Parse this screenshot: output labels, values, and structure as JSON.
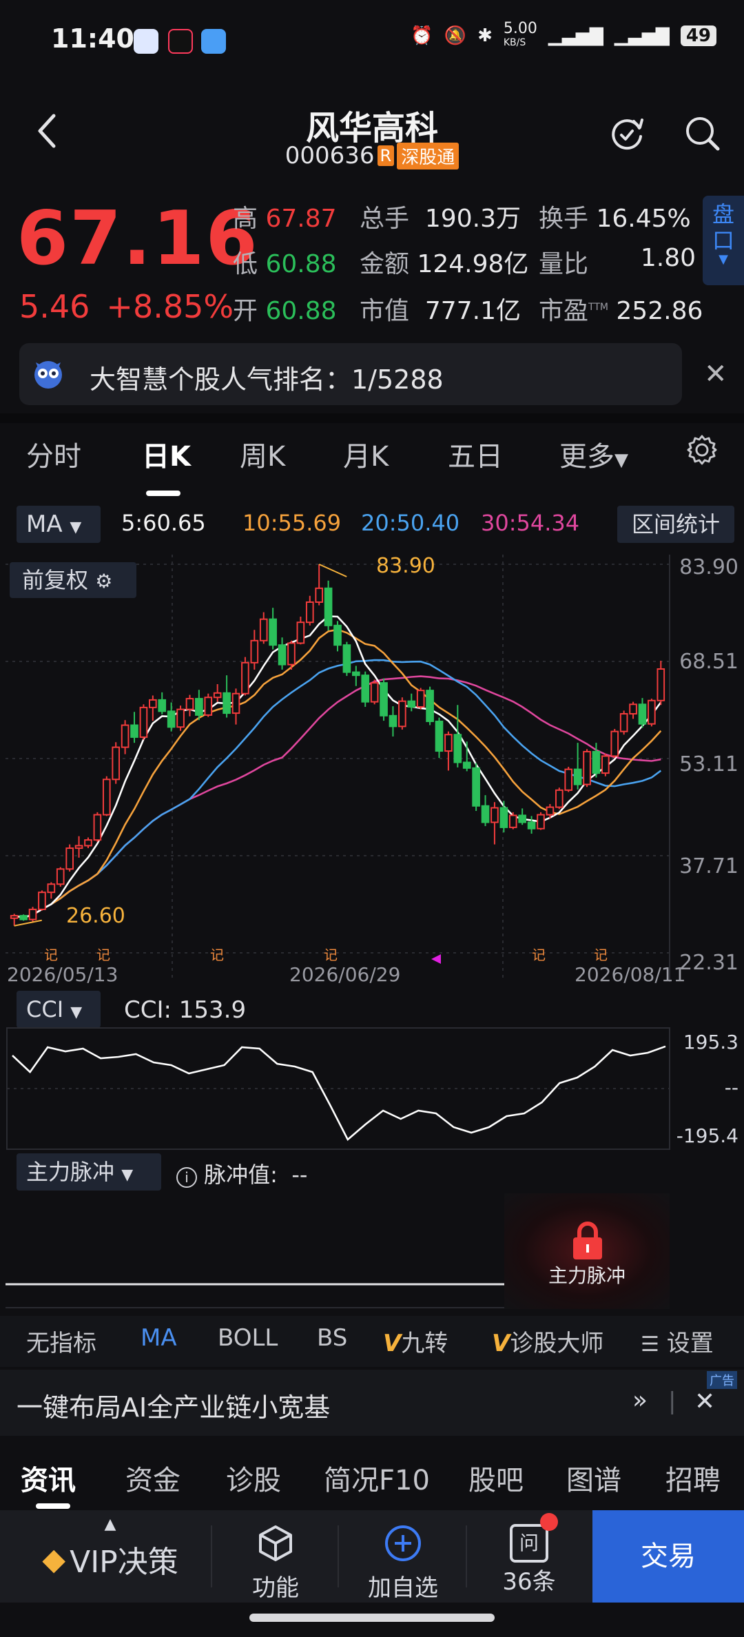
{
  "status": {
    "time": "11:40",
    "net_speed": "5.00",
    "net_unit": "KB/S",
    "battery": "49"
  },
  "header": {
    "name": "风华高科",
    "code": "000636",
    "tag_r": "R",
    "tag_connect": "深股通"
  },
  "quote": {
    "price": "67.16",
    "change": "5.46",
    "change_pct": "+8.85%",
    "high_label": "高",
    "high": "67.87",
    "low_label": "低",
    "low": "60.88",
    "open_label": "开",
    "open": "60.88",
    "vol_label": "总手",
    "vol": "190.3万",
    "amount_label": "金额",
    "amount": "124.98亿",
    "mktcap_label": "市值",
    "mktcap": "777.1亿",
    "turnover_label": "换手",
    "turnover": "16.45%",
    "volratio_label": "量比",
    "volratio": "1.80",
    "pe_label": "市盈",
    "pe_suffix": "TTM",
    "pe": "252.86",
    "pankou": "盘口"
  },
  "rank": {
    "text": "大智慧个股人气排名：1/5288"
  },
  "period_tabs": [
    "分时",
    "日K",
    "周K",
    "月K",
    "五日",
    "更多"
  ],
  "ma_row": {
    "select": "MA",
    "ma5": "5:60.65",
    "ma10": "10:55.69",
    "ma20": "20:50.40",
    "ma30": "30:54.34",
    "interval": "区间统计"
  },
  "fq_label": "前复权",
  "colors": {
    "up": "#f23c3c",
    "down": "#2bbf5a",
    "ma5": "#ffffff",
    "ma10": "#f6a23c",
    "ma20": "#4aa3f0",
    "ma30": "#e0479e"
  },
  "chart_data": {
    "type": "candlestick",
    "y_ticks": [
      "83.90",
      "68.51",
      "53.11",
      "37.71",
      "22.31"
    ],
    "x_labels": [
      "2026/05/13",
      "2026/06/29",
      "2026/08/11"
    ],
    "high_marker": "83.90",
    "low_marker": "26.60",
    "ylim": [
      22.31,
      83.9
    ],
    "candles": [
      [
        27.8,
        28.5,
        26.6,
        28.2
      ],
      [
        28.2,
        28.4,
        27.4,
        27.6
      ],
      [
        27.6,
        29.6,
        27.2,
        29.2
      ],
      [
        29.2,
        32.2,
        29.0,
        31.9
      ],
      [
        31.9,
        33.5,
        30.9,
        33.2
      ],
      [
        33.2,
        35.9,
        32.8,
        35.6
      ],
      [
        35.6,
        39.5,
        35.2,
        38.9
      ],
      [
        38.9,
        40.8,
        37.4,
        39.3
      ],
      [
        39.3,
        40.6,
        38.9,
        40.2
      ],
      [
        40.2,
        44.6,
        39.9,
        44.2
      ],
      [
        44.2,
        50.3,
        44.0,
        49.8
      ],
      [
        49.8,
        55.7,
        49.1,
        54.9
      ],
      [
        54.9,
        59.2,
        53.8,
        58.4
      ],
      [
        58.4,
        60.5,
        55.6,
        56.5
      ],
      [
        56.5,
        61.7,
        56.1,
        61.2
      ],
      [
        61.2,
        63.1,
        59.1,
        62.4
      ],
      [
        62.4,
        63.6,
        60.1,
        60.6
      ],
      [
        60.6,
        62.0,
        57.4,
        58.1
      ],
      [
        58.1,
        61.5,
        57.5,
        60.9
      ],
      [
        60.9,
        63.2,
        59.8,
        62.6
      ],
      [
        62.6,
        64.0,
        59.2,
        60.0
      ],
      [
        60.0,
        63.4,
        59.7,
        62.8
      ],
      [
        62.8,
        64.9,
        62.1,
        63.5
      ],
      [
        63.5,
        66.3,
        59.6,
        60.3
      ],
      [
        60.3,
        64.2,
        58.5,
        63.4
      ],
      [
        63.4,
        69.2,
        63.1,
        68.3
      ],
      [
        68.3,
        73.5,
        67.2,
        71.8
      ],
      [
        71.8,
        76.3,
        71.3,
        75.2
      ],
      [
        75.2,
        77.0,
        70.4,
        71.1
      ],
      [
        71.1,
        72.3,
        67.2,
        68.0
      ],
      [
        68.0,
        71.8,
        67.2,
        71.4
      ],
      [
        71.4,
        75.6,
        71.2,
        74.7
      ],
      [
        74.7,
        78.9,
        74.2,
        77.9
      ],
      [
        77.9,
        83.9,
        77.4,
        80.1
      ],
      [
        80.1,
        81.3,
        73.4,
        74.2
      ],
      [
        74.2,
        74.9,
        70.1,
        71.1
      ],
      [
        71.1,
        71.6,
        66.2,
        66.8
      ],
      [
        66.8,
        67.8,
        64.6,
        66.3
      ],
      [
        66.3,
        66.9,
        61.3,
        62.1
      ],
      [
        62.1,
        65.6,
        61.7,
        65.1
      ],
      [
        65.1,
        65.8,
        59.1,
        59.9
      ],
      [
        59.9,
        61.4,
        56.6,
        58.2
      ],
      [
        58.2,
        62.8,
        57.7,
        62.2
      ],
      [
        62.2,
        63.4,
        60.6,
        61.3
      ],
      [
        61.3,
        64.3,
        60.9,
        63.9
      ],
      [
        63.9,
        64.5,
        58.4,
        59.0
      ],
      [
        59.0,
        59.6,
        53.2,
        54.3
      ],
      [
        54.3,
        57.4,
        51.2,
        56.9
      ],
      [
        56.9,
        61.6,
        51.7,
        52.5
      ],
      [
        52.5,
        55.8,
        51.1,
        51.6
      ],
      [
        51.6,
        52.4,
        44.8,
        45.6
      ],
      [
        45.6,
        47.3,
        42.4,
        43.0
      ],
      [
        43.0,
        46.2,
        39.5,
        45.3
      ],
      [
        45.3,
        46.4,
        41.4,
        42.2
      ],
      [
        42.2,
        44.6,
        41.9,
        44.1
      ],
      [
        44.1,
        45.2,
        42.6,
        43.0
      ],
      [
        43.0,
        44.0,
        41.2,
        42.0
      ],
      [
        42.0,
        44.6,
        41.8,
        44.2
      ],
      [
        44.2,
        45.9,
        43.6,
        45.4
      ],
      [
        45.4,
        48.5,
        45.1,
        48.1
      ],
      [
        48.1,
        51.8,
        47.8,
        51.4
      ],
      [
        51.4,
        55.6,
        48.2,
        49.0
      ],
      [
        49.0,
        54.6,
        48.6,
        54.2
      ],
      [
        54.2,
        55.6,
        50.1,
        50.8
      ],
      [
        50.8,
        53.9,
        50.3,
        53.5
      ],
      [
        53.5,
        57.8,
        53.2,
        57.4
      ],
      [
        57.4,
        60.7,
        56.9,
        60.2
      ],
      [
        60.2,
        62.1,
        59.4,
        61.7
      ],
      [
        61.7,
        62.7,
        58.0,
        58.6
      ],
      [
        58.6,
        62.6,
        58.2,
        62.3
      ],
      [
        62.3,
        68.6,
        61.6,
        67.3
      ]
    ],
    "cci": {
      "label": "CCI: 153.9",
      "ticks": [
        "195.3",
        "--",
        "-195.4"
      ],
      "values": [
        120,
        60,
        150,
        135,
        145,
        110,
        115,
        125,
        95,
        85,
        55,
        70,
        85,
        150,
        145,
        90,
        80,
        60,
        -60,
        -185,
        -130,
        -80,
        -110,
        -80,
        -90,
        -140,
        -160,
        -140,
        -100,
        -90,
        -50,
        20,
        40,
        80,
        140,
        120,
        130,
        153
      ]
    }
  },
  "pulse": {
    "select": "主力脉冲",
    "label": "脉冲值:",
    "value": "--",
    "lock_text": "主力脉冲"
  },
  "indicator_tabs": [
    "无指标",
    "MA",
    "BOLL",
    "BS",
    "九转",
    "诊股大师",
    "设置"
  ],
  "ad": {
    "text": "一键布局AI全产业链小宽基",
    "tag": "广告"
  },
  "news_tabs": [
    "资讯",
    "资金",
    "诊股",
    "简况F10",
    "股吧",
    "图谱",
    "招聘"
  ],
  "bottom_bar": {
    "vip": "VIP决策",
    "func": "功能",
    "add": "加自选",
    "count": "36条",
    "count_icon": "问",
    "trade": "交易"
  }
}
